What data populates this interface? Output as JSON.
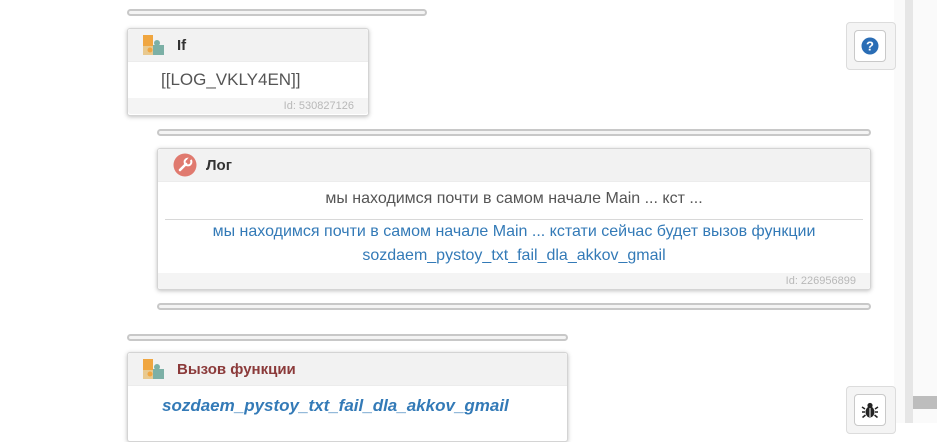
{
  "if_block": {
    "title": "If",
    "condition": "[[LOG_VKLY4EN]]",
    "id_label": "Id: 530827126"
  },
  "log_block": {
    "title": "Лог",
    "summary": "мы находимся почти в самом начале Main ... кст ...",
    "message_line1": "мы находимся почти в самом начале Main ... кстати сейчас будет вызов функции",
    "message_line2": "sozdaem_pystoy_txt_fail_dla_akkov_gmail",
    "id_label": "Id: 226956899"
  },
  "call_block": {
    "title": "Вызов функции",
    "function_name": "sozdaem_pystoy_txt_fail_dla_akkov_gmail"
  },
  "colors": {
    "link_blue": "#337ab7",
    "call_title_red": "#8b3a3a",
    "help_blue": "#2a6db5"
  },
  "icons": {
    "if_icon": "puzzle-icon",
    "log_icon": "wrench-icon",
    "call_icon": "puzzle-icon",
    "help_icon": "question-circle-icon",
    "debug_icon": "bug-icon"
  }
}
